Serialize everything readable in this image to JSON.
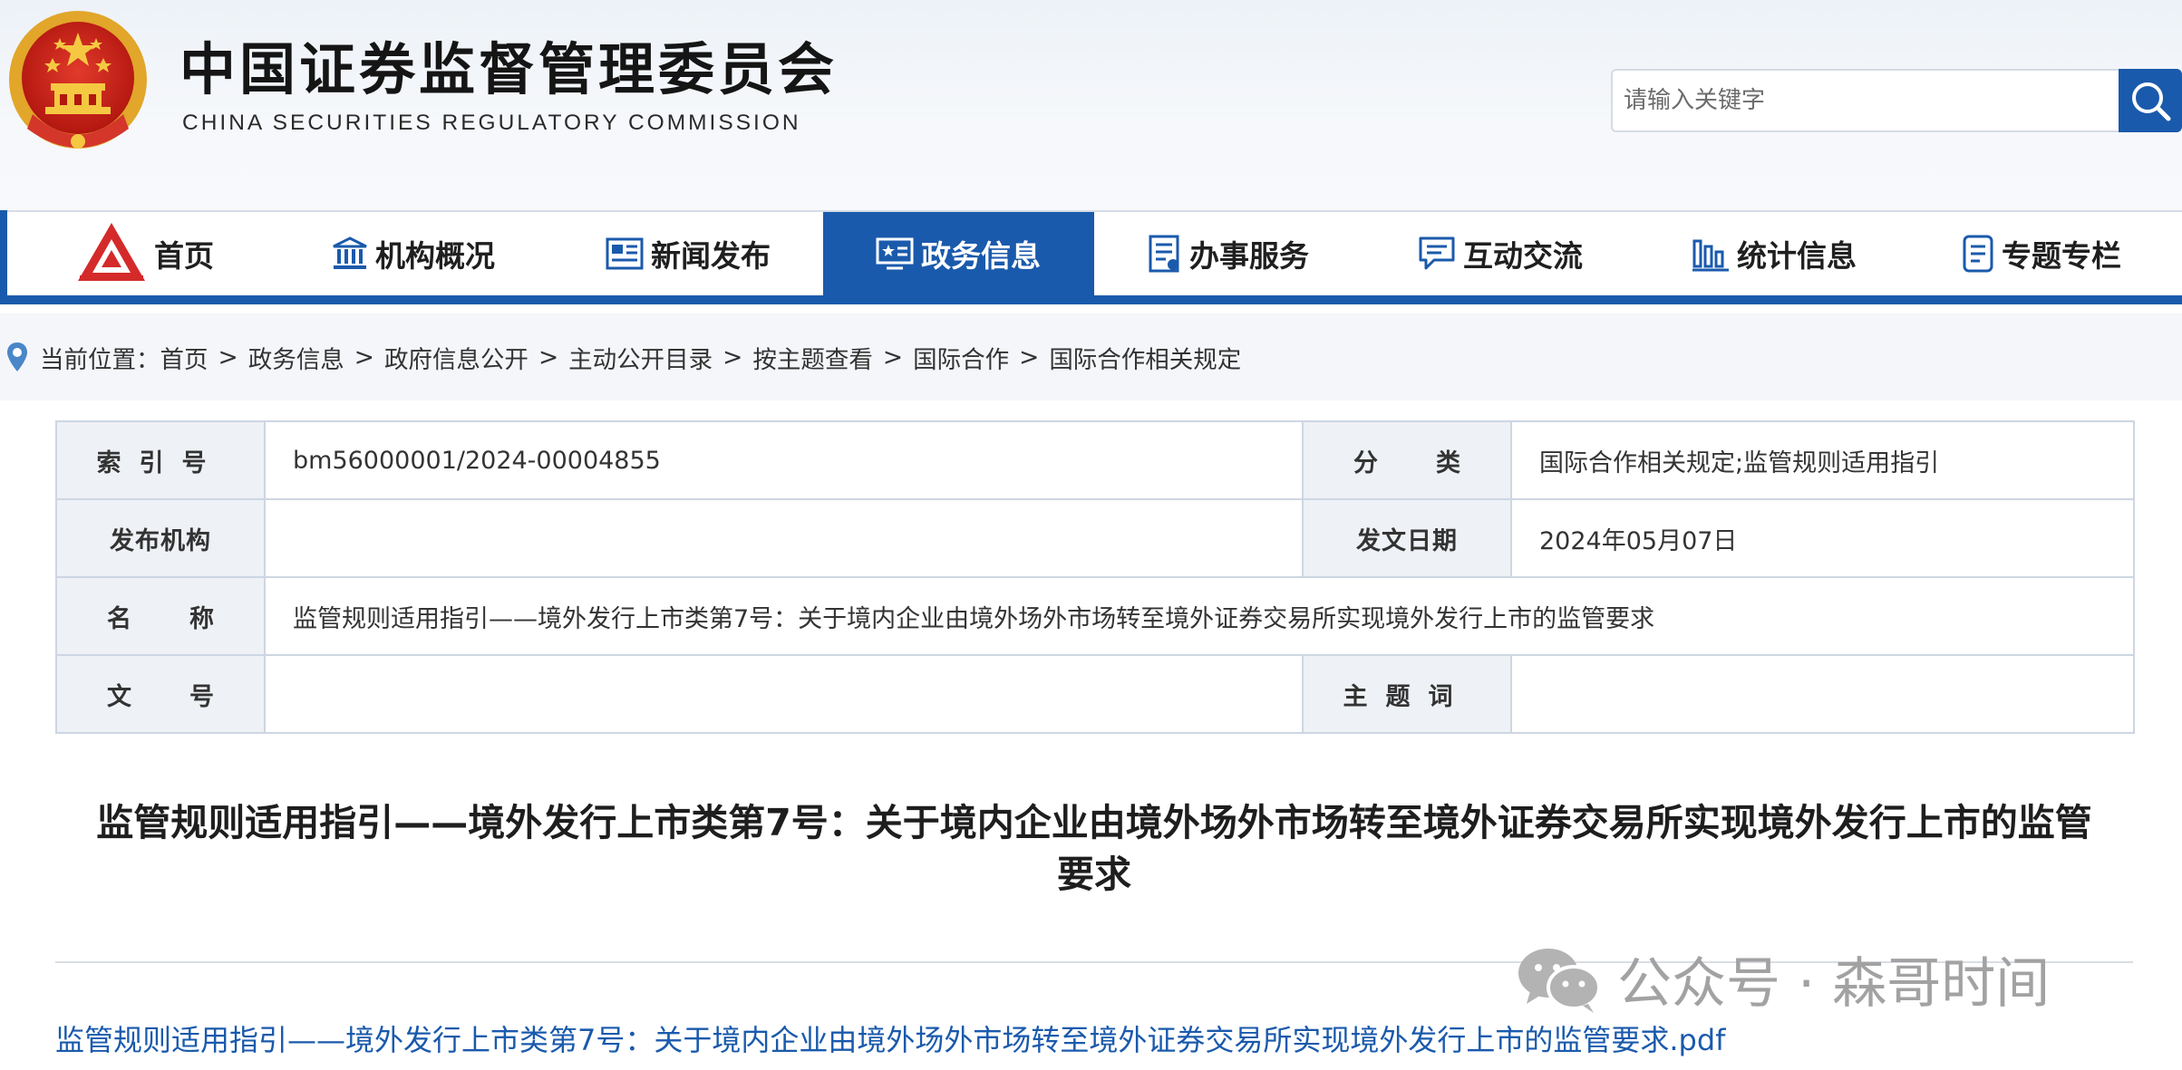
{
  "header": {
    "title_cn": "中国证券监督管理委员会",
    "title_en": "CHINA SECURITIES REGULATORY COMMISSION",
    "search_placeholder": "请输入关键字"
  },
  "nav": {
    "items": [
      {
        "label": "首页",
        "icon": "csrc-logo-icon"
      },
      {
        "label": "机构概况",
        "icon": "building-icon"
      },
      {
        "label": "新闻发布",
        "icon": "newspaper-icon"
      },
      {
        "label": "政务信息",
        "icon": "screen-star-icon",
        "active": true
      },
      {
        "label": "办事服务",
        "icon": "document-list-icon"
      },
      {
        "label": "互动交流",
        "icon": "chat-icon"
      },
      {
        "label": "统计信息",
        "icon": "bar-chart-icon"
      },
      {
        "label": "专题专栏",
        "icon": "note-icon"
      }
    ],
    "accent_color": "#1a5aac"
  },
  "breadcrumb": {
    "prefix": "当前位置：",
    "items": [
      "首页",
      "政务信息",
      "政府信息公开",
      "主动公开目录",
      "按主题查看",
      "国际合作",
      "国际合作相关规定"
    ],
    "separator": ">"
  },
  "meta": {
    "index_label": "索引号",
    "index_value": "bm56000001/2024-00004855",
    "category_label": "分类",
    "category_value": "国际合作相关规定;监管规则适用指引",
    "publisher_label": "发布机构",
    "publisher_value": "",
    "date_label": "发文日期",
    "date_value": "2024年05月07日",
    "name_label": "名称",
    "name_value": "监管规则适用指引——境外发行上市类第7号：关于境内企业由境外场外市场转至境外证券交易所实现境外发行上市的监管要求",
    "docno_label": "文号",
    "docno_value": "",
    "keywords_label": "主题词",
    "keywords_value": ""
  },
  "article": {
    "title_line1": "监管规则适用指引——境外发行上市类第7号：关于境内企业由境外场外市场转至境外证券交易所实现境外发行上市的监管",
    "title_line2": "要求",
    "attachment": "监管规则适用指引——境外发行上市类第7号：关于境内企业由境外场外市场转至境外证券交易所实现境外发行上市的监管要求.pdf"
  },
  "watermark": {
    "text": "公众号 · 森哥时间",
    "icon": "wechat-icon"
  }
}
